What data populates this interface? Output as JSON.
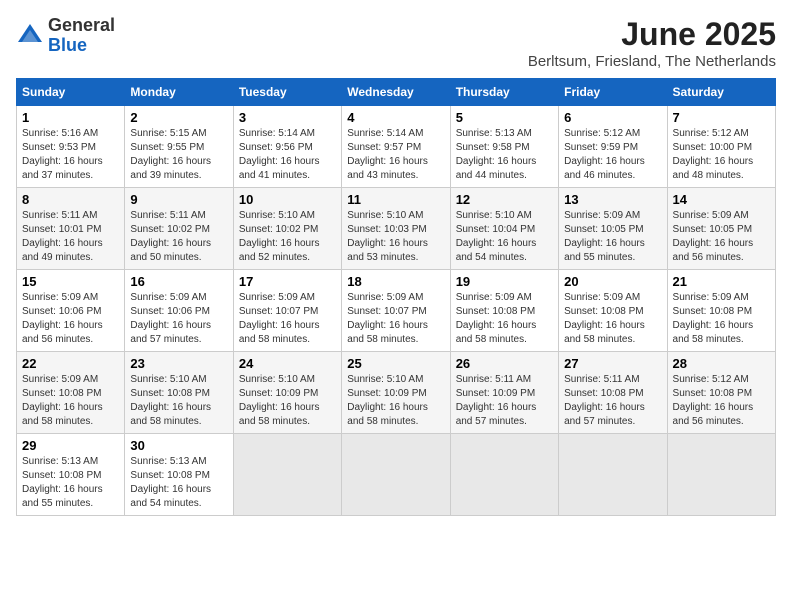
{
  "logo": {
    "general": "General",
    "blue": "Blue"
  },
  "title": "June 2025",
  "subtitle": "Berltsum, Friesland, The Netherlands",
  "days_of_week": [
    "Sunday",
    "Monday",
    "Tuesday",
    "Wednesday",
    "Thursday",
    "Friday",
    "Saturday"
  ],
  "weeks": [
    [
      {
        "day": "1",
        "sunrise": "5:16 AM",
        "sunset": "9:53 PM",
        "daylight": "16 hours and 37 minutes."
      },
      {
        "day": "2",
        "sunrise": "5:15 AM",
        "sunset": "9:55 PM",
        "daylight": "16 hours and 39 minutes."
      },
      {
        "day": "3",
        "sunrise": "5:14 AM",
        "sunset": "9:56 PM",
        "daylight": "16 hours and 41 minutes."
      },
      {
        "day": "4",
        "sunrise": "5:14 AM",
        "sunset": "9:57 PM",
        "daylight": "16 hours and 43 minutes."
      },
      {
        "day": "5",
        "sunrise": "5:13 AM",
        "sunset": "9:58 PM",
        "daylight": "16 hours and 44 minutes."
      },
      {
        "day": "6",
        "sunrise": "5:12 AM",
        "sunset": "9:59 PM",
        "daylight": "16 hours and 46 minutes."
      },
      {
        "day": "7",
        "sunrise": "5:12 AM",
        "sunset": "10:00 PM",
        "daylight": "16 hours and 48 minutes."
      }
    ],
    [
      {
        "day": "8",
        "sunrise": "5:11 AM",
        "sunset": "10:01 PM",
        "daylight": "16 hours and 49 minutes."
      },
      {
        "day": "9",
        "sunrise": "5:11 AM",
        "sunset": "10:02 PM",
        "daylight": "16 hours and 50 minutes."
      },
      {
        "day": "10",
        "sunrise": "5:10 AM",
        "sunset": "10:02 PM",
        "daylight": "16 hours and 52 minutes."
      },
      {
        "day": "11",
        "sunrise": "5:10 AM",
        "sunset": "10:03 PM",
        "daylight": "16 hours and 53 minutes."
      },
      {
        "day": "12",
        "sunrise": "5:10 AM",
        "sunset": "10:04 PM",
        "daylight": "16 hours and 54 minutes."
      },
      {
        "day": "13",
        "sunrise": "5:09 AM",
        "sunset": "10:05 PM",
        "daylight": "16 hours and 55 minutes."
      },
      {
        "day": "14",
        "sunrise": "5:09 AM",
        "sunset": "10:05 PM",
        "daylight": "16 hours and 56 minutes."
      }
    ],
    [
      {
        "day": "15",
        "sunrise": "5:09 AM",
        "sunset": "10:06 PM",
        "daylight": "16 hours and 56 minutes."
      },
      {
        "day": "16",
        "sunrise": "5:09 AM",
        "sunset": "10:06 PM",
        "daylight": "16 hours and 57 minutes."
      },
      {
        "day": "17",
        "sunrise": "5:09 AM",
        "sunset": "10:07 PM",
        "daylight": "16 hours and 58 minutes."
      },
      {
        "day": "18",
        "sunrise": "5:09 AM",
        "sunset": "10:07 PM",
        "daylight": "16 hours and 58 minutes."
      },
      {
        "day": "19",
        "sunrise": "5:09 AM",
        "sunset": "10:08 PM",
        "daylight": "16 hours and 58 minutes."
      },
      {
        "day": "20",
        "sunrise": "5:09 AM",
        "sunset": "10:08 PM",
        "daylight": "16 hours and 58 minutes."
      },
      {
        "day": "21",
        "sunrise": "5:09 AM",
        "sunset": "10:08 PM",
        "daylight": "16 hours and 58 minutes."
      }
    ],
    [
      {
        "day": "22",
        "sunrise": "5:09 AM",
        "sunset": "10:08 PM",
        "daylight": "16 hours and 58 minutes."
      },
      {
        "day": "23",
        "sunrise": "5:10 AM",
        "sunset": "10:08 PM",
        "daylight": "16 hours and 58 minutes."
      },
      {
        "day": "24",
        "sunrise": "5:10 AM",
        "sunset": "10:09 PM",
        "daylight": "16 hours and 58 minutes."
      },
      {
        "day": "25",
        "sunrise": "5:10 AM",
        "sunset": "10:09 PM",
        "daylight": "16 hours and 58 minutes."
      },
      {
        "day": "26",
        "sunrise": "5:11 AM",
        "sunset": "10:09 PM",
        "daylight": "16 hours and 57 minutes."
      },
      {
        "day": "27",
        "sunrise": "5:11 AM",
        "sunset": "10:08 PM",
        "daylight": "16 hours and 57 minutes."
      },
      {
        "day": "28",
        "sunrise": "5:12 AM",
        "sunset": "10:08 PM",
        "daylight": "16 hours and 56 minutes."
      }
    ],
    [
      {
        "day": "29",
        "sunrise": "5:13 AM",
        "sunset": "10:08 PM",
        "daylight": "16 hours and 55 minutes."
      },
      {
        "day": "30",
        "sunrise": "5:13 AM",
        "sunset": "10:08 PM",
        "daylight": "16 hours and 54 minutes."
      },
      null,
      null,
      null,
      null,
      null
    ]
  ],
  "label_sunrise": "Sunrise:",
  "label_sunset": "Sunset:",
  "label_daylight": "Daylight:"
}
